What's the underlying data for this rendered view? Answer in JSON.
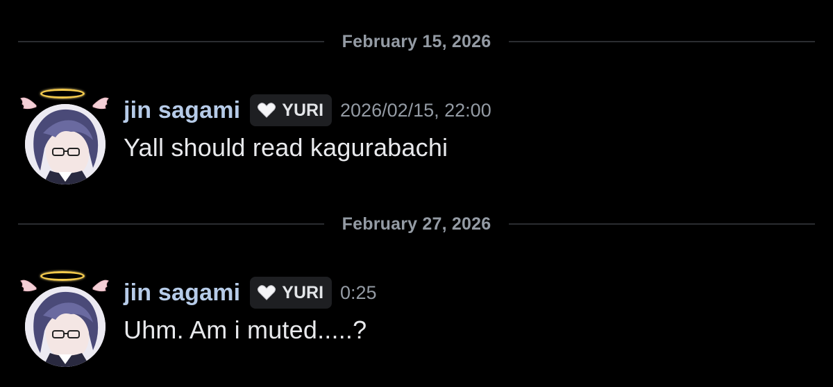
{
  "dividers": [
    {
      "date": "February 15, 2026"
    },
    {
      "date": "February 27, 2026"
    }
  ],
  "messages": [
    {
      "author": "jin sagami",
      "tag": "YURI",
      "timestamp": "2026/02/15, 22:00",
      "text": "Yall should read kagurabachi"
    },
    {
      "author": "jin sagami",
      "tag": "YURI",
      "timestamp": "0:25",
      "text": "Uhm. Am i muted.....?"
    }
  ],
  "icons": {
    "tag_icon": "heart-icon",
    "avatar_decoration": "halo-wings"
  },
  "colors": {
    "background": "#000000",
    "username": "#b6cbe8",
    "message_text": "#e8e9ec",
    "muted_text": "#949ba4",
    "tag_background": "#1e1f22",
    "halo": "#f2c94c"
  }
}
